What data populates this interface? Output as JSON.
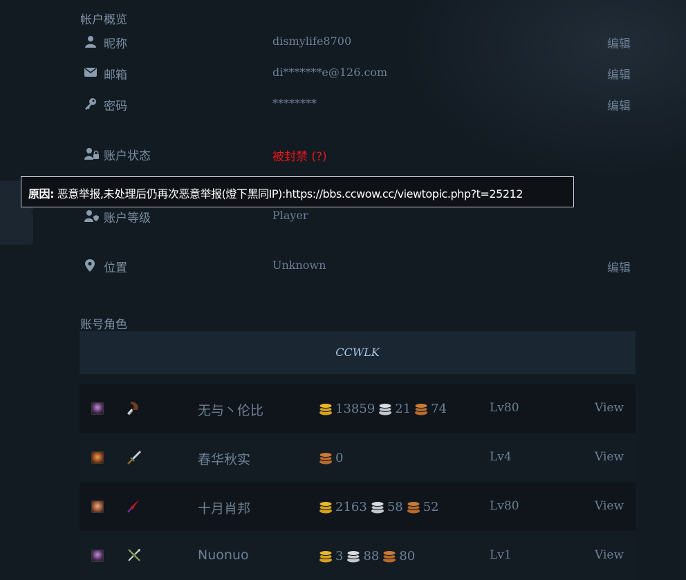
{
  "account_overview": {
    "title": "帐户概览",
    "rows": [
      {
        "label": "昵称",
        "value": "dismylife8700",
        "edit": "编辑"
      },
      {
        "label": "邮箱",
        "value": "di*******e@126.com",
        "edit": "编辑"
      },
      {
        "label": "密码",
        "value": "********",
        "edit": "编辑"
      },
      {
        "label": "账户状态",
        "value": "被封禁 (?)"
      },
      {
        "label": "账户等级",
        "value": "Player"
      },
      {
        "label": "位置",
        "value": "Unknown",
        "edit": "编辑"
      }
    ],
    "icons": [
      "user-icon",
      "envelope-icon",
      "key-icon",
      "user-lock-icon",
      "user-shield-icon",
      "map-marker-icon"
    ]
  },
  "tooltip": {
    "prefix": "原因:",
    "text": " 恶意举报,未处理后仍再次恶意举报(燈下黑同IP):https://bbs.ccwow.cc/viewtopic.php?t=25212"
  },
  "characters": {
    "title": "账号角色",
    "realm": "CCWLK",
    "view_label": "View",
    "rows": [
      {
        "name": "无与丶伦比",
        "race_icon": "undead-female-portrait",
        "class_icon": "rogue-icon",
        "gold": "13859",
        "silver": "21",
        "copper": "74",
        "level": "Lv80"
      },
      {
        "name": "春华秋实",
        "race_icon": "human-female-portrait",
        "class_icon": "warrior-icon",
        "copper": "0",
        "level": "Lv4"
      },
      {
        "name": "十月肖邦",
        "race_icon": "human-male-portrait",
        "class_icon": "mage-icon",
        "gold": "2163",
        "silver": "58",
        "copper": "52",
        "level": "Lv80"
      },
      {
        "name": "Nuonuo",
        "race_icon": "undead-female-portrait",
        "class_icon": "hunter-icon",
        "gold": "3",
        "silver": "88",
        "copper": "80",
        "level": "Lv1"
      }
    ]
  },
  "colors": {
    "background": "#121a22",
    "muted_text": "#6d8094",
    "banned_red": "#e8151b",
    "gold": "#d7a21a",
    "silver": "#c3c7cc",
    "copper": "#b8692b",
    "realm_text": "#a8c6e4"
  }
}
